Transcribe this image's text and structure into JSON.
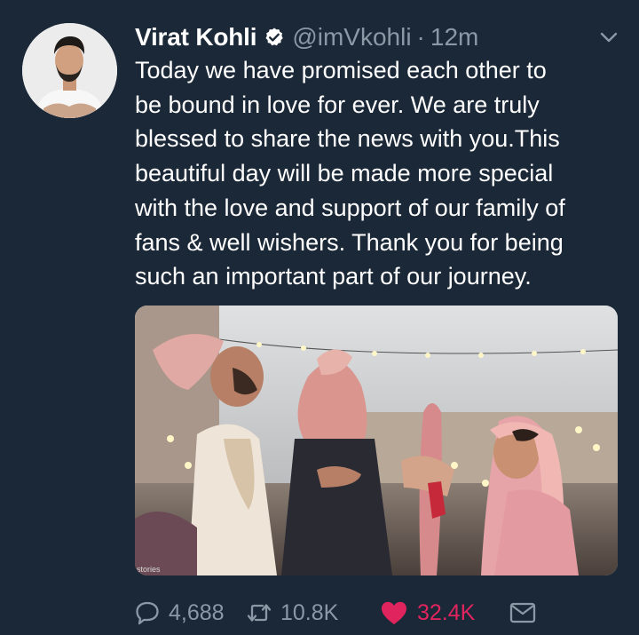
{
  "tweet": {
    "author_name": "Virat Kohli",
    "handle": "@imVkohli",
    "separator": "·",
    "time": "12m",
    "lines": [
      "Today we have promised each other to",
      "be bound in love for ever. We are truly",
      "blessed to share the news with you.This",
      "beautiful day will be made more special",
      "with the love and support of our family of",
      "fans & well wishers. Thank you for being",
      "such an important part of our journey."
    ],
    "media_watermark": "stories",
    "stats": {
      "replies": "4,688",
      "retweets": "10.8K",
      "likes": "32.4K"
    }
  },
  "colors": {
    "background": "#1b2837",
    "secondary_text": "#8b98a5",
    "like_active": "#e0245e",
    "verified_badge": "#ffffff"
  },
  "icons": {
    "verified": "verified-badge-icon",
    "caret": "chevron-down-icon",
    "reply": "reply-icon",
    "retweet": "retweet-icon",
    "like": "heart-icon",
    "share": "envelope-icon"
  }
}
